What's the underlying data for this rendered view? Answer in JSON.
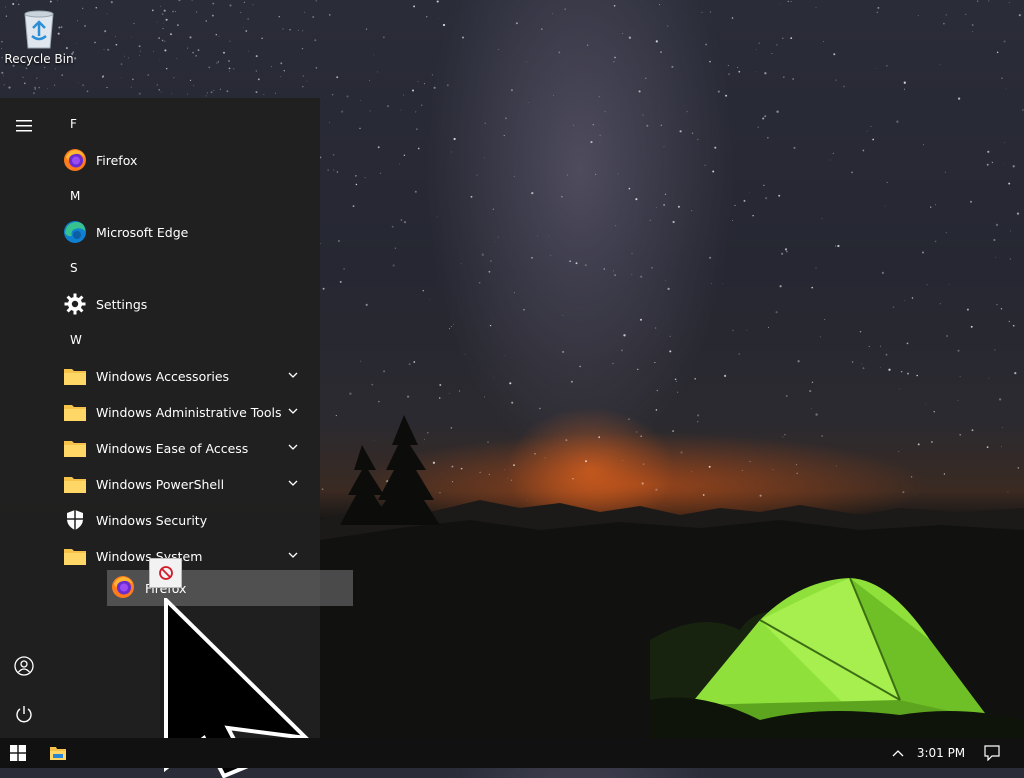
{
  "desktop": {
    "icons": [
      {
        "label": "Recycle Bin",
        "icon": "recycle-bin-icon"
      }
    ]
  },
  "start_menu": {
    "rail": {
      "top_icon": "hamburger-menu-icon",
      "bottom_icons": [
        "user-account-icon",
        "power-icon"
      ]
    },
    "groups": [
      {
        "letter": "F",
        "items": [
          {
            "label": "Firefox",
            "icon": "firefox-icon",
            "expandable": false
          }
        ]
      },
      {
        "letter": "M",
        "items": [
          {
            "label": "Microsoft Edge",
            "icon": "edge-icon",
            "expandable": false
          }
        ]
      },
      {
        "letter": "S",
        "items": [
          {
            "label": "Settings",
            "icon": "gear-icon",
            "expandable": false
          }
        ]
      },
      {
        "letter": "W",
        "items": [
          {
            "label": "Windows Accessories",
            "icon": "folder-icon",
            "expandable": true
          },
          {
            "label": "Windows Administrative Tools",
            "icon": "folder-icon",
            "expandable": true
          },
          {
            "label": "Windows Ease of Access",
            "icon": "folder-icon",
            "expandable": true
          },
          {
            "label": "Windows PowerShell",
            "icon": "folder-icon",
            "expandable": true
          },
          {
            "label": "Windows Security",
            "icon": "shield-icon",
            "expandable": false
          },
          {
            "label": "Windows System",
            "icon": "folder-icon",
            "expandable": true
          }
        ]
      }
    ]
  },
  "drag": {
    "label": "Firefox",
    "icon": "firefox-icon",
    "indicator_icon": "no-drop-icon"
  },
  "taskbar": {
    "start_icon": "windows-start-icon",
    "pinned": [
      "file-explorer-icon"
    ],
    "tray_icon": "show-hidden-icons-chevron",
    "clock": "3:01 PM",
    "notification_icon": "action-center-icon"
  },
  "colors": {
    "start_menu_bg": "#202020",
    "taskbar_bg": "#111111",
    "drag_ghost_bg": "#787878",
    "tent_green": "#8fe03a"
  }
}
